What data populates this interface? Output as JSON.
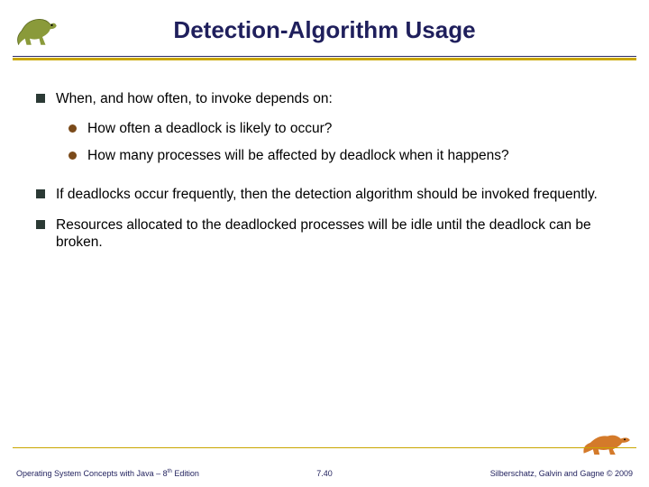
{
  "title": "Detection-Algorithm Usage",
  "bullets": {
    "b1": "When, and how often, to invoke depends on:",
    "b1a": "How often a deadlock is likely to occur?",
    "b1b": "How many processes will be affected by deadlock when it happens?",
    "b2": "If deadlocks occur frequently, then the detection algorithm should be invoked frequently.",
    "b3": "Resources allocated to the deadlocked processes will be idle until the deadlock can be broken."
  },
  "footer": {
    "left_a": "Operating System Concepts with Java – 8",
    "left_sup": "th",
    "left_b": " Edition",
    "center": "7.40",
    "right": "Silberschatz, Galvin and Gagne © 2009"
  },
  "icons": {
    "dino_left": "dinosaur-icon",
    "dino_right": "dinosaur-icon"
  }
}
